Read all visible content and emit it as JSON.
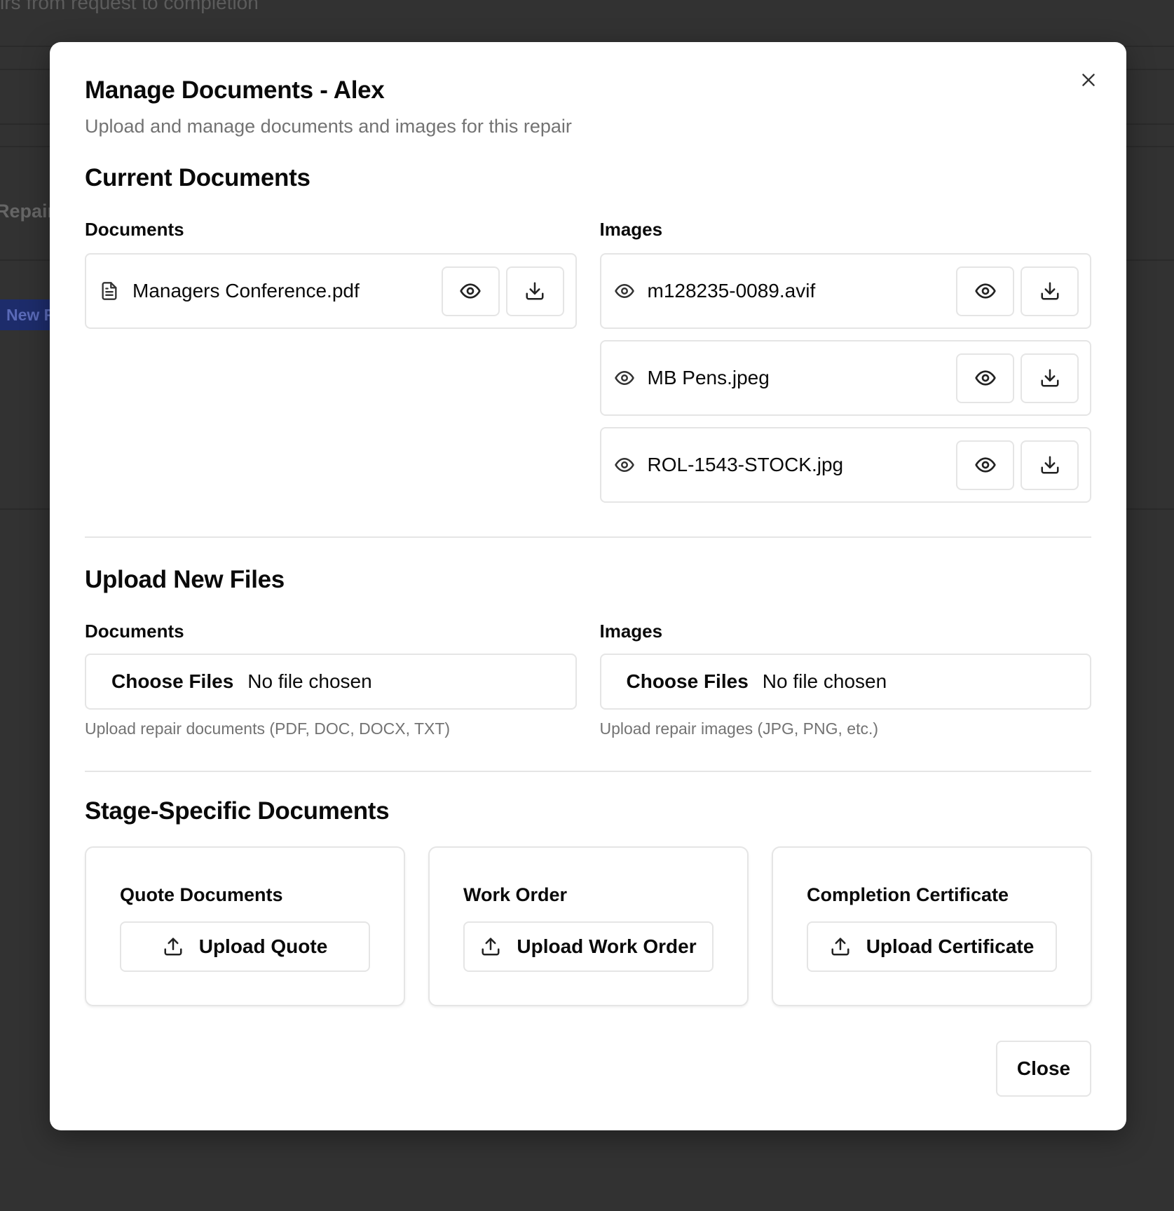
{
  "background": {
    "subtitle_fragment": "irs from request to completion",
    "heading_fragment": "Repairs",
    "badge_fragment": "New R"
  },
  "modal": {
    "title": "Manage Documents - Alex",
    "subtitle": "Upload and manage documents and images for this repair",
    "close_icon": "x-icon"
  },
  "current": {
    "title": "Current Documents",
    "documents_label": "Documents",
    "images_label": "Images",
    "documents": [
      {
        "name": "Managers Conference.pdf",
        "icon": "file-text-icon"
      }
    ],
    "images": [
      {
        "name": "m128235-0089.avif",
        "icon": "eye-icon"
      },
      {
        "name": "MB Pens.jpeg",
        "icon": "eye-icon"
      },
      {
        "name": "ROL-1543-STOCK.jpg",
        "icon": "eye-icon"
      }
    ]
  },
  "upload": {
    "title": "Upload New Files",
    "documents": {
      "label": "Documents",
      "button": "Choose Files",
      "status": "No file chosen",
      "hint": "Upload repair documents (PDF, DOC, DOCX, TXT)"
    },
    "images": {
      "label": "Images",
      "button": "Choose Files",
      "status": "No file chosen",
      "hint": "Upload repair images (JPG, PNG, etc.)"
    }
  },
  "stage": {
    "title": "Stage-Specific Documents",
    "cards": [
      {
        "title": "Quote Documents",
        "button": "Upload Quote"
      },
      {
        "title": "Work Order",
        "button": "Upload Work Order"
      },
      {
        "title": "Completion Certificate",
        "button": "Upload Certificate"
      }
    ]
  },
  "footer": {
    "close_label": "Close"
  },
  "colors": {
    "overlay": "#313131",
    "border": "#e5e5e5",
    "muted_text": "#737373",
    "text": "#0a0a0a"
  }
}
